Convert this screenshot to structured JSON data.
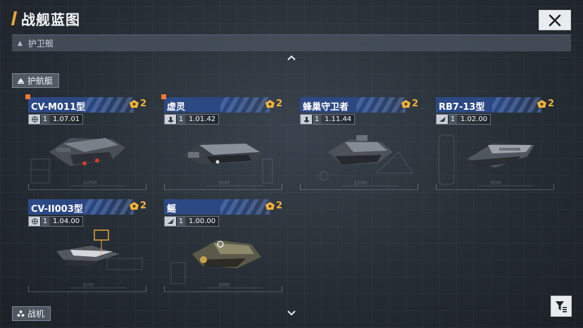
{
  "header": {
    "title": "战舰蓝图",
    "close_icon": "close-icon"
  },
  "category_bar": {
    "label": "护卫舰",
    "icon": "triangle-up-icon"
  },
  "sections": {
    "escort": {
      "label": "护航艇",
      "icon": "ship-class-icon"
    },
    "fighter": {
      "label": "战机",
      "icon": "fighter-class-icon"
    }
  },
  "cards": [
    {
      "name": "CV-M011型",
      "count": "2",
      "level": "1",
      "multiplier": "1.07.01",
      "new": true,
      "type_icon": "globe-icon"
    },
    {
      "name": "虚灵",
      "count": "2",
      "level": "1",
      "multiplier": "1.01.42",
      "new": true,
      "type_icon": "tower-icon"
    },
    {
      "name": "蜂巢守卫者",
      "count": "2",
      "level": "1",
      "multiplier": "1.11.44",
      "new": false,
      "type_icon": "tower-icon"
    },
    {
      "name": "RB7-13型",
      "count": "2",
      "level": "1",
      "multiplier": "1.02.00",
      "new": false,
      "type_icon": "wing-icon"
    },
    {
      "name": "CV-II003型",
      "count": "2",
      "level": "1",
      "multiplier": "1.04.00",
      "new": false,
      "type_icon": "globe-icon"
    },
    {
      "name": "鳐",
      "count": "2",
      "level": "1",
      "multiplier": "1.00.00",
      "new": false,
      "type_icon": "wing-icon"
    }
  ],
  "colors": {
    "accent": "#e8a33a",
    "name_bar": "#2d4a86",
    "count": "#f2b43c",
    "new_marker": "#f07a30"
  },
  "filter_icon": "filter-icon"
}
